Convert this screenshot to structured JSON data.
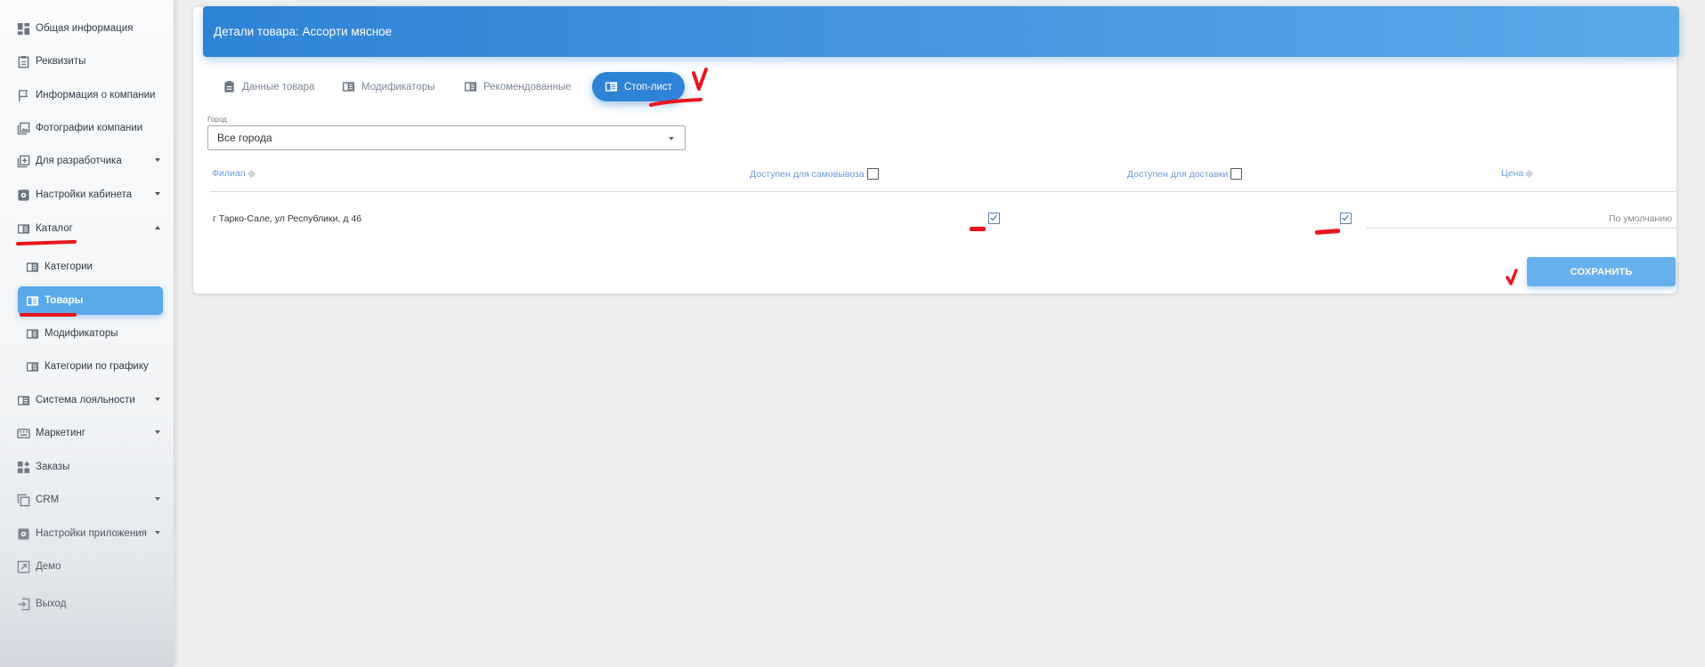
{
  "sidebar": {
    "items": [
      {
        "label": "Общая информация",
        "icon": "dashboard-icon"
      },
      {
        "label": "Реквизиты",
        "icon": "clipboard-icon"
      },
      {
        "label": "Информация о компании",
        "icon": "flag-icon"
      },
      {
        "label": "Фотографии компании",
        "icon": "photo-library-icon"
      },
      {
        "label": "Для разработчика",
        "icon": "add-box-icon"
      },
      {
        "label": "Настройки кабинета",
        "icon": "gear-icon"
      },
      {
        "label": "Каталог",
        "icon": "book-icon"
      },
      {
        "label": "Категории",
        "icon": "book-icon"
      },
      {
        "label": "Товары",
        "icon": "book-icon"
      },
      {
        "label": "Модификаторы",
        "icon": "book-icon"
      },
      {
        "label": "Категории по графику",
        "icon": "book-icon"
      },
      {
        "label": "Система лояльности",
        "icon": "book-icon"
      },
      {
        "label": "Маркетинг",
        "icon": "keyboard-icon"
      },
      {
        "label": "Заказы",
        "icon": "widgets-icon"
      },
      {
        "label": "CRM",
        "icon": "copy-icon"
      },
      {
        "label": "Настройки приложения",
        "icon": "gear-icon"
      },
      {
        "label": "Демо",
        "icon": "shortcut-icon"
      },
      {
        "label": "Выход",
        "icon": "exit-icon"
      }
    ]
  },
  "header": {
    "title": "Детали товара: Ассорти мясное"
  },
  "tabs": [
    {
      "label": "Данные товара",
      "icon": "clipboard-icon"
    },
    {
      "label": "Модификаторы",
      "icon": "book-icon"
    },
    {
      "label": "Рекомендованные",
      "icon": "book-icon"
    },
    {
      "label": "Стоп-лист",
      "icon": "book-icon"
    }
  ],
  "city_filter": {
    "label": "Город",
    "value": "Все города"
  },
  "table": {
    "headers": {
      "branch": "Филиал",
      "pickup": "Доступен для самовывоза",
      "delivery": "Доступен для доставки",
      "price": "Цена"
    },
    "rows": [
      {
        "branch": "г Тарко-Сале, ул Республики, д 46",
        "pickup": true,
        "delivery": true,
        "price": "По умолчанию"
      }
    ]
  },
  "save_label": "СОХРАНИТЬ",
  "colors": {
    "accent": "#2f83d6",
    "active_nav": "#5aa9ea",
    "annotation": "#e8161c"
  }
}
